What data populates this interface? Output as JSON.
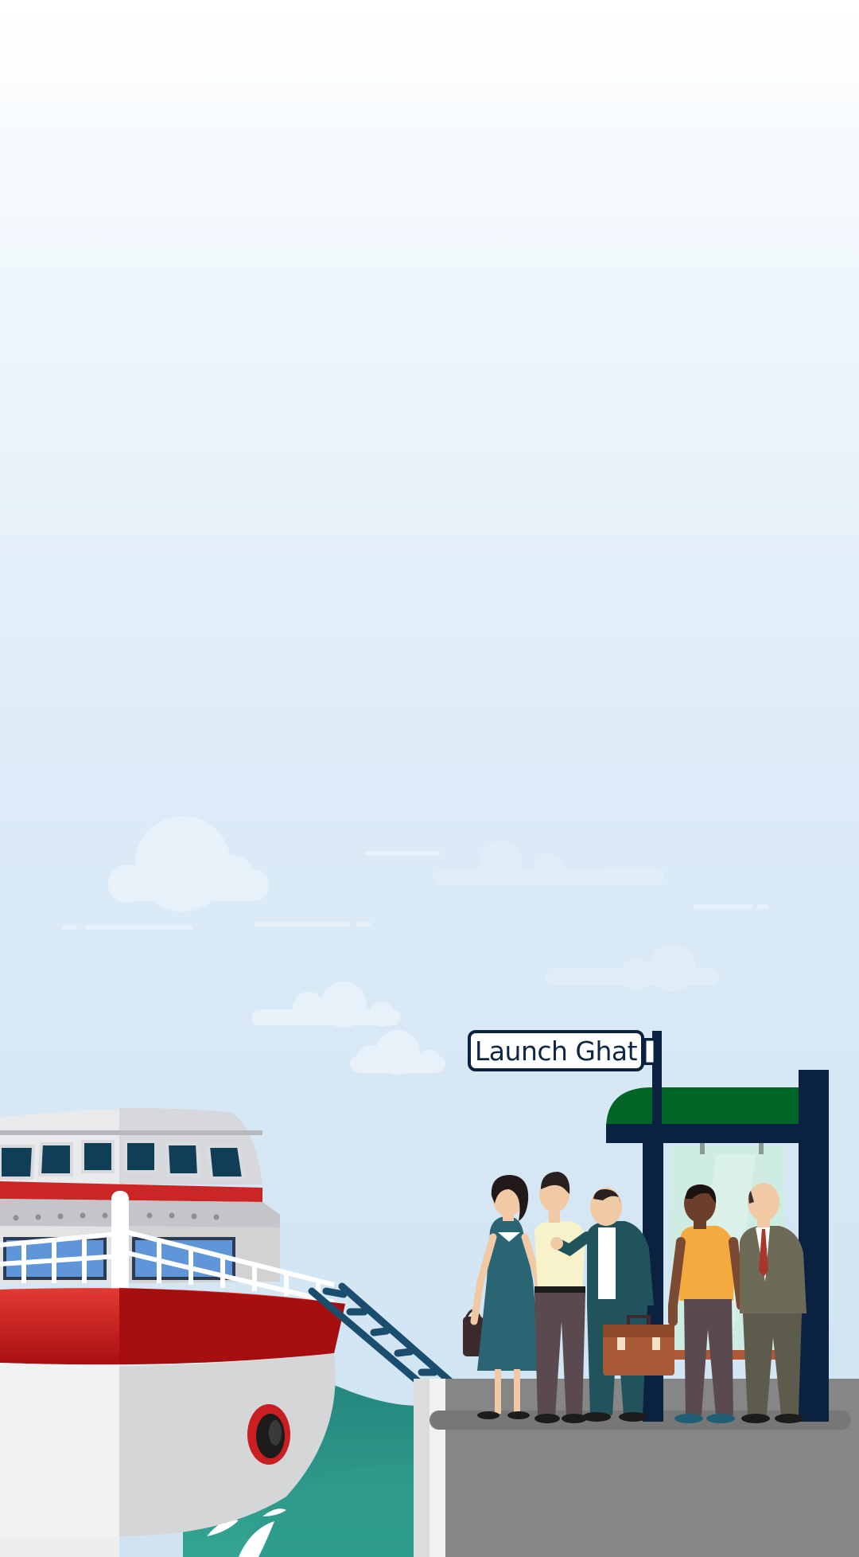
{
  "sign": {
    "label": "Launch Ghat"
  },
  "colors": {
    "sky_top": "#ffffff",
    "sky_mid": "#e8f3fb",
    "sky_bottom": "#cfe3f2",
    "cloud": "#e6f1f9",
    "water": "#2a8f86",
    "platform": "#858585",
    "shelter_roof": "#036427",
    "shelter_frame": "#0a2240",
    "ship_red": "#c71f1f",
    "ship_white": "#eeeeee"
  },
  "icons": [
    "cloud-icon",
    "ship-illustration",
    "ladder-icon",
    "shelter-icon",
    "person-icon",
    "briefcase-icon",
    "handbag-icon"
  ]
}
